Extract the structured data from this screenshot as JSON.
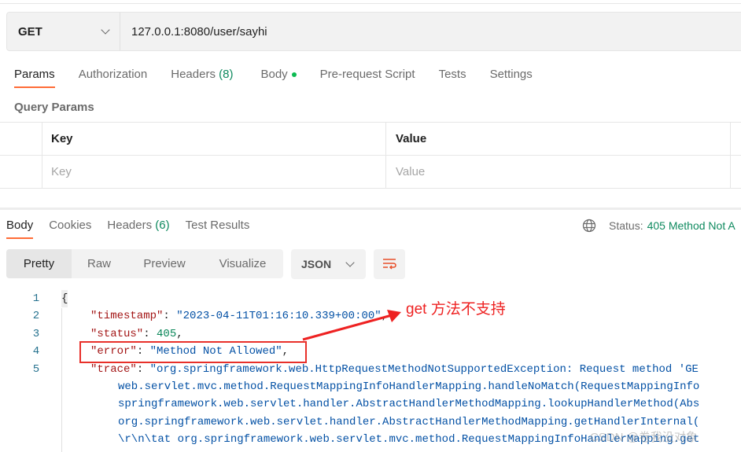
{
  "request": {
    "method": "GET",
    "url": "127.0.0.1:8080/user/sayhi"
  },
  "request_tabs": [
    {
      "label": "Params",
      "active": true
    },
    {
      "label": "Authorization"
    },
    {
      "label": "Headers",
      "count": "(8)"
    },
    {
      "label": "Body",
      "dot": true
    },
    {
      "label": "Pre-request Script"
    },
    {
      "label": "Tests"
    },
    {
      "label": "Settings"
    }
  ],
  "query_params": {
    "title": "Query Params",
    "columns": [
      "Key",
      "Value"
    ],
    "placeholders": {
      "key": "Key",
      "value": "Value"
    }
  },
  "response_tabs": [
    {
      "label": "Body",
      "active": true
    },
    {
      "label": "Cookies"
    },
    {
      "label": "Headers",
      "count": "(6)"
    },
    {
      "label": "Test Results"
    }
  ],
  "status": {
    "label": "Status:",
    "value": "405 Method Not A"
  },
  "view_modes": [
    "Pretty",
    "Raw",
    "Preview",
    "Visualize"
  ],
  "format": "JSON",
  "code": {
    "line_numbers": [
      "1",
      "2",
      "3",
      "4",
      "5"
    ],
    "open": "{",
    "timestamp_key": "\"timestamp\"",
    "timestamp_val": "\"2023-04-11T01:16:10.339+00:00\"",
    "status_key": "\"status\"",
    "status_val": "405",
    "error_key": "\"error\"",
    "error_val": "\"Method Not Allowed\"",
    "trace_key": "\"trace\"",
    "trace_lines": [
      "\"org.springframework.web.HttpRequestMethodNotSupportedException: Request method 'GE",
      "web.servlet.mvc.method.RequestMappingInfoHandlerMapping.handleNoMatch(RequestMappingInfo",
      "springframework.web.servlet.handler.AbstractHandlerMethodMapping.lookupHandlerMethod(Abs",
      "org.springframework.web.servlet.handler.AbstractHandlerMethodMapping.getHandlerInternal(",
      "\\r\\n\\tat org.springframework.web.servlet.mvc.method.RequestMappingInfoHandlerMapping.get"
    ]
  },
  "annotation": {
    "text": "get 方法不支持",
    "color": "#ee2222"
  },
  "watermark": "CSDN @卷我没对象",
  "colors": {
    "accent": "#ff6c37",
    "success": "#0f8a5f"
  }
}
